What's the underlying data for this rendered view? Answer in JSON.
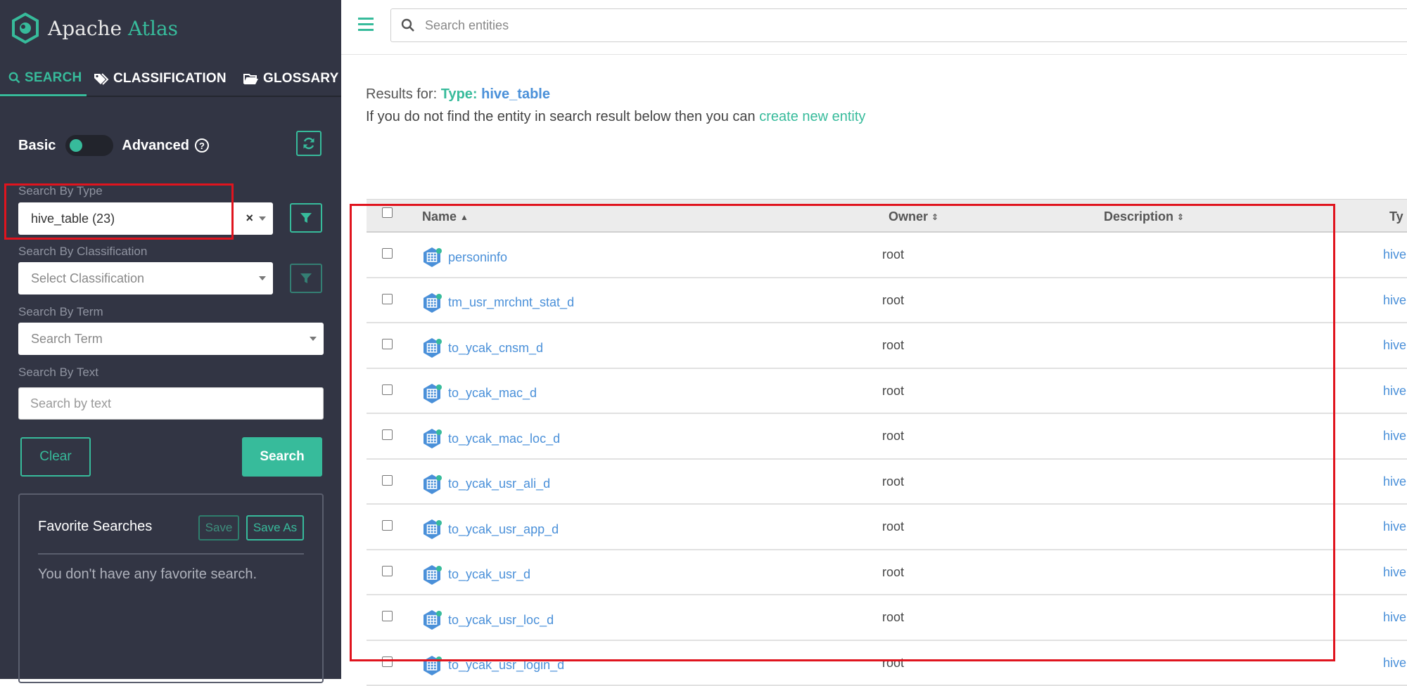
{
  "brand": {
    "name_part1": "Apache",
    "name_part2": "Atlas"
  },
  "tabs": [
    {
      "label": "SEARCH",
      "icon": "search-icon",
      "active": true
    },
    {
      "label": "CLASSIFICATION",
      "icon": "tags-icon",
      "active": false
    },
    {
      "label": "GLOSSARY",
      "icon": "folder-open-icon",
      "active": false
    }
  ],
  "search_panel": {
    "mode_basic": "Basic",
    "mode_advanced": "Advanced",
    "type_label": "Search By Type",
    "type_value": "hive_table (23)",
    "classification_label": "Search By Classification",
    "classification_placeholder": "Select Classification",
    "term_label": "Search By Term",
    "term_placeholder": "Search Term",
    "text_label": "Search By Text",
    "text_placeholder": "Search by text",
    "clear_label": "Clear",
    "search_label": "Search"
  },
  "favorites": {
    "title": "Favorite Searches",
    "save_label": "Save",
    "save_as_label": "Save As",
    "empty_text": "You don't have any favorite search."
  },
  "topbar": {
    "search_placeholder": "Search entities"
  },
  "results": {
    "prefix": "Results for:",
    "type_key": "Type:",
    "type_value": "hive_table",
    "hint_text": "If you do not find the entity in search result below then you can",
    "hint_link": "create new entity"
  },
  "table": {
    "headers": {
      "name": "Name",
      "owner": "Owner",
      "description": "Description",
      "type": "Ty"
    },
    "rows": [
      {
        "name": "personinfo",
        "owner": "root",
        "type": "hive"
      },
      {
        "name": "tm_usr_mrchnt_stat_d",
        "owner": "root",
        "type": "hive"
      },
      {
        "name": "to_ycak_cnsm_d",
        "owner": "root",
        "type": "hive"
      },
      {
        "name": "to_ycak_mac_d",
        "owner": "root",
        "type": "hive"
      },
      {
        "name": "to_ycak_mac_loc_d",
        "owner": "root",
        "type": "hive"
      },
      {
        "name": "to_ycak_usr_ali_d",
        "owner": "root",
        "type": "hive"
      },
      {
        "name": "to_ycak_usr_app_d",
        "owner": "root",
        "type": "hive"
      },
      {
        "name": "to_ycak_usr_d",
        "owner": "root",
        "type": "hive"
      },
      {
        "name": "to_ycak_usr_loc_d",
        "owner": "root",
        "type": "hive"
      },
      {
        "name": "to_ycak_usr_login_d",
        "owner": "root",
        "type": "hive"
      }
    ]
  },
  "colors": {
    "accent": "#37bb9b",
    "sidebar_bg": "#323544",
    "link": "#4a90d9",
    "highlight": "#e0141e"
  }
}
